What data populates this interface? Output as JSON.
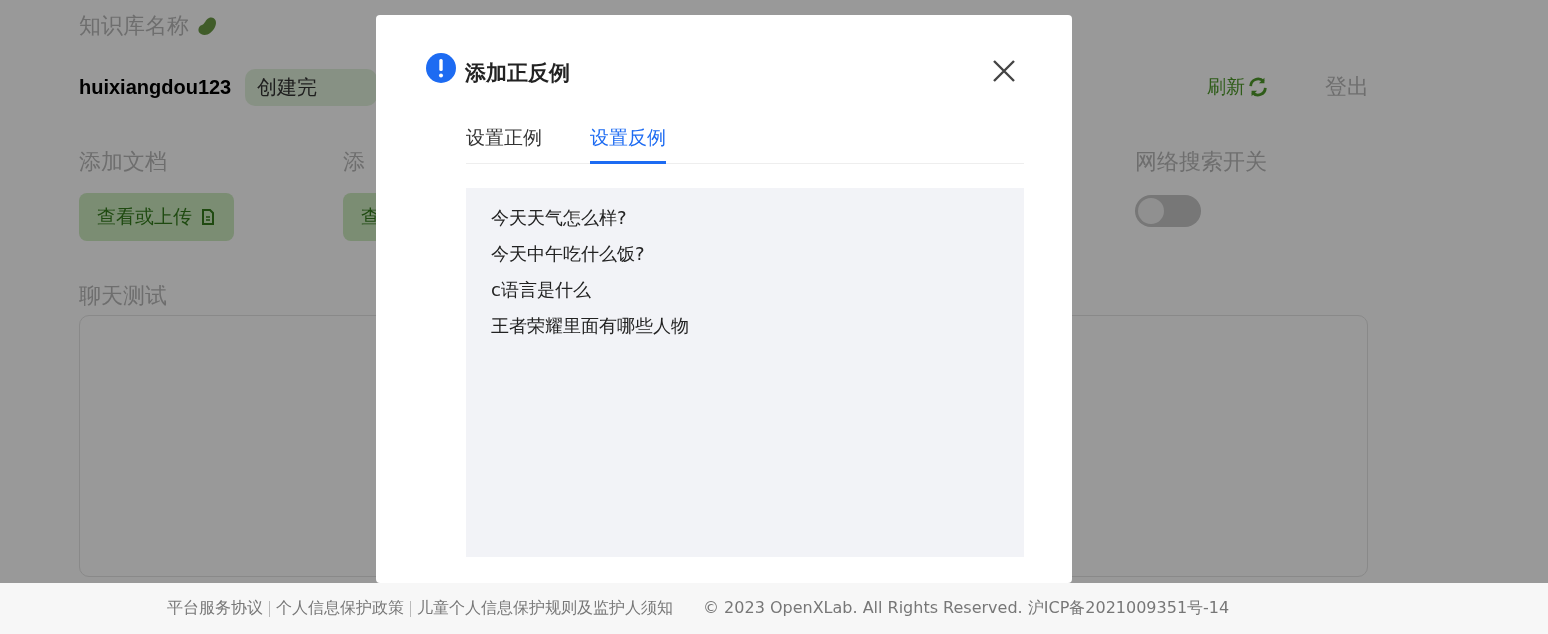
{
  "page": {
    "kb_label": "知识库名称",
    "kb_name": "huixiangdou123",
    "status_badge": "创建完",
    "refresh": "刷新",
    "logout": "登出",
    "sections": [
      {
        "kind": "button",
        "title": "添加文档",
        "button": "查看或上传",
        "icon": true
      },
      {
        "kind": "button",
        "title": "添",
        "button": "查",
        "icon": false
      },
      {
        "kind": "switch",
        "title": "网络搜索开关",
        "on": false
      }
    ],
    "chat_title": "聊天测试"
  },
  "dialog": {
    "title": "添加正反例",
    "tabs": [
      {
        "label": "设置正例",
        "selected": false
      },
      {
        "label": "设置反例",
        "selected": true
      }
    ],
    "textarea": {
      "lines": [
        "今天天气怎么样?",
        "今天中午吃什么饭?",
        "c语言是什么",
        "王者荣耀里面有哪些人物"
      ]
    }
  },
  "footer": {
    "links": [
      "平台服务协议",
      "个人信息保护政策",
      "儿童个人信息保护规则及监护人须知"
    ],
    "copyright": "© 2023 OpenXLab. All Rights Reserved. 沪ICP备2021009351号-14"
  }
}
